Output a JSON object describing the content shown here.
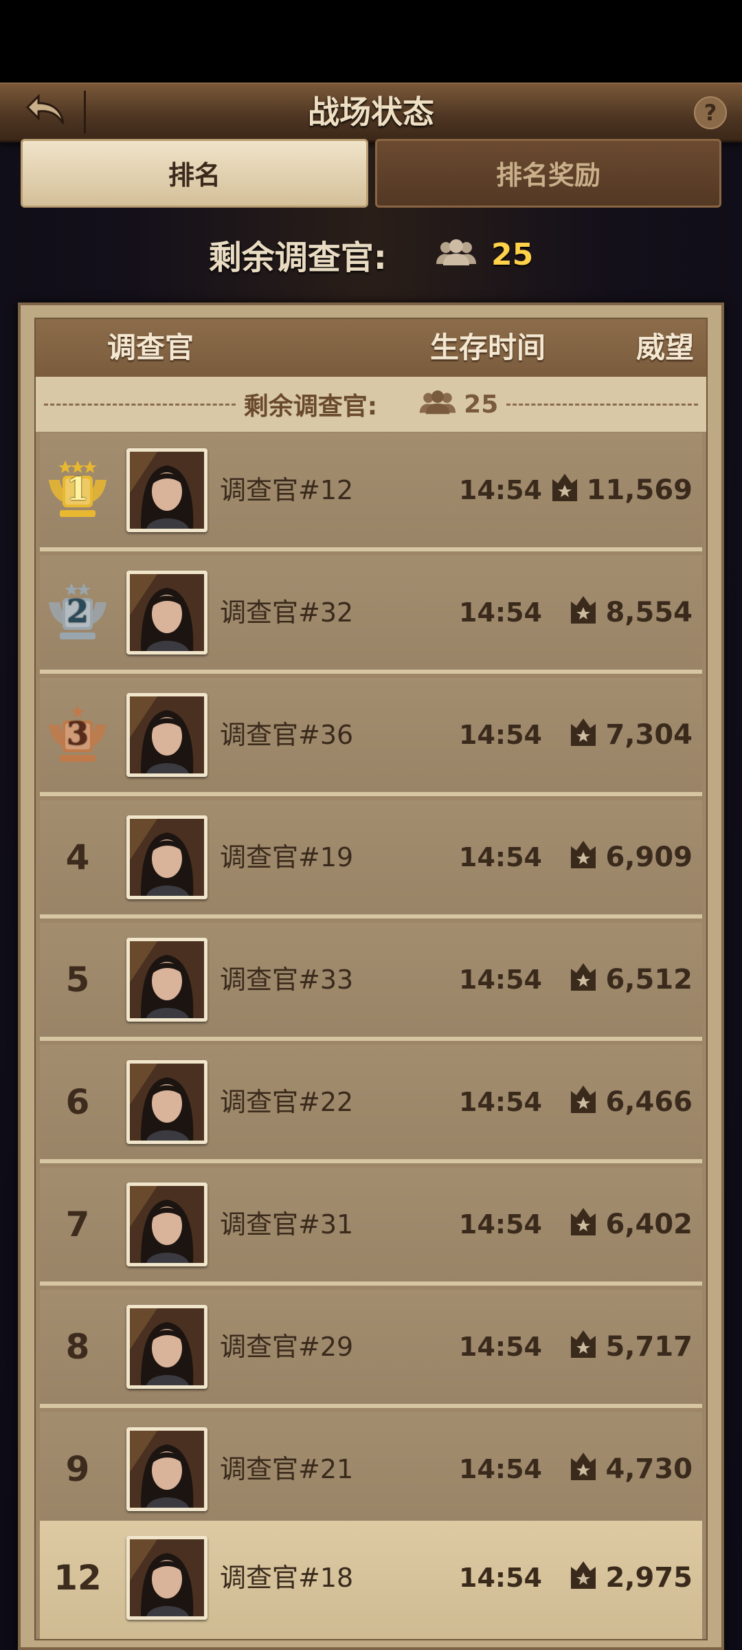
{
  "header": {
    "title": "战场状态",
    "help_label": "?"
  },
  "tabs": [
    {
      "label": "排名",
      "active": true
    },
    {
      "label": "排名奖励",
      "active": false
    }
  ],
  "remaining": {
    "label": "剩余调查官:",
    "count": "25"
  },
  "table": {
    "columns": {
      "name": "调查官",
      "time": "生存时间",
      "prestige": "威望"
    },
    "divider": {
      "label": "剩余调查官:",
      "count": "25"
    },
    "rows": [
      {
        "rank": "1",
        "name": "调查官#12",
        "time": "14:54",
        "prestige": "11,569"
      },
      {
        "rank": "2",
        "name": "调查官#32",
        "time": "14:54",
        "prestige": "8,554"
      },
      {
        "rank": "3",
        "name": "调查官#36",
        "time": "14:54",
        "prestige": "7,304"
      },
      {
        "rank": "4",
        "name": "调查官#19",
        "time": "14:54",
        "prestige": "6,909"
      },
      {
        "rank": "5",
        "name": "调查官#33",
        "time": "14:54",
        "prestige": "6,512"
      },
      {
        "rank": "6",
        "name": "调查官#22",
        "time": "14:54",
        "prestige": "6,466"
      },
      {
        "rank": "7",
        "name": "调查官#31",
        "time": "14:54",
        "prestige": "6,402"
      },
      {
        "rank": "8",
        "name": "调查官#29",
        "time": "14:54",
        "prestige": "5,717"
      },
      {
        "rank": "9",
        "name": "调查官#21",
        "time": "14:54",
        "prestige": "4,730"
      }
    ],
    "self_row": {
      "rank": "12",
      "name": "调查官#18",
      "time": "14:54",
      "prestige": "2,975"
    }
  },
  "colors": {
    "gold": "#e8b830",
    "silver": "#9aa6ad",
    "bronze": "#c07a4a",
    "count_highlight": "#ffd24a"
  }
}
